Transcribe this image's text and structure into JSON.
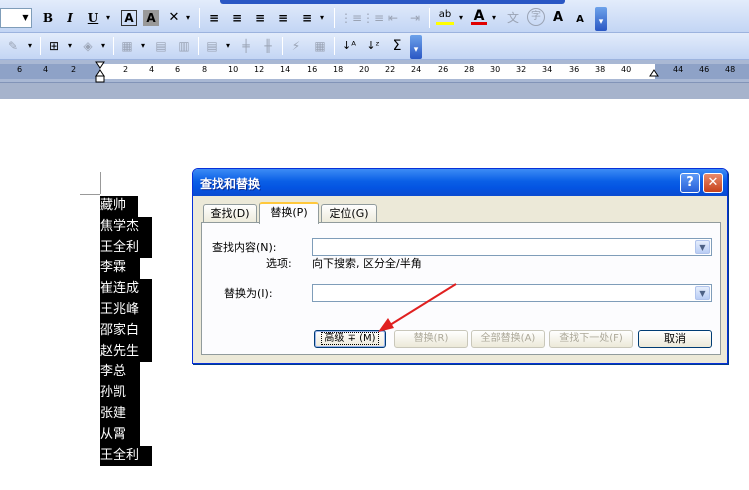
{
  "toolbar1": {
    "bold": "B",
    "italic": "I",
    "underline": "U",
    "char_border": "A",
    "char_shading": "A",
    "align_left": "≡",
    "center": "≡",
    "align_right": "≡",
    "justify": "≡",
    "line_spacing": "≡",
    "numbering": "⋮≡",
    "bullets": "⋮≡",
    "decrease_indent": "⇤",
    "increase_indent": "⇥",
    "highlight": "ab",
    "font_color": "A",
    "phonetic": "文",
    "enclose": "字",
    "grow_font": "A",
    "shrink_font": "A"
  },
  "toolbar2": {
    "sum": "Σ"
  },
  "ruler": {
    "ticks": [
      "6",
      "4",
      "2",
      "2",
      "4",
      "6",
      "8",
      "10",
      "12",
      "14",
      "16",
      "18",
      "20",
      "22",
      "24",
      "26",
      "28",
      "30",
      "32",
      "34",
      "36",
      "38",
      "40",
      "44",
      "46",
      "48"
    ]
  },
  "document": {
    "names": [
      "藏帅",
      "焦学杰",
      "王全利",
      "李霖",
      "崔连成",
      "王兆峰",
      "邵家白",
      "赵先生",
      "李总",
      "孙凯",
      "张建",
      "从霄",
      "王全利"
    ]
  },
  "dialog": {
    "title": "查找和替换",
    "help": "?",
    "close": "✕",
    "tabs": [
      "查找(D)",
      "替换(P)",
      "定位(G)"
    ],
    "find_label": "查找内容(N):",
    "find_value": "",
    "options_label": "选项:",
    "options_value": "向下搜索, 区分全/半角",
    "replace_label": "替换为(I):",
    "replace_value": "",
    "buttons": {
      "advanced": "高级 ∓ (M)",
      "replace": "替换(R)",
      "replace_all": "全部替换(A)",
      "find_next": "查找下一处(F)",
      "cancel": "取消"
    }
  },
  "colors": {
    "titlebar": "#0454e2",
    "dialog_bg": "#ece9d8",
    "arrow": "#e02020"
  }
}
